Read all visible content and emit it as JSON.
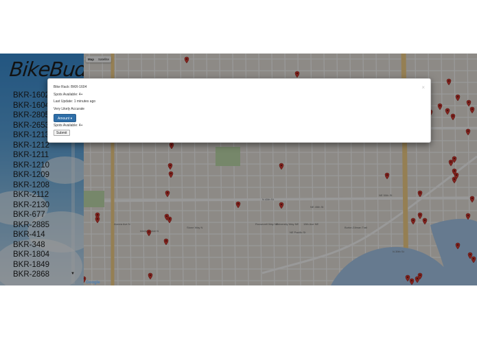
{
  "app": {
    "logo": "BikeBud"
  },
  "sidebar": {
    "racks": [
      "BKR-1602",
      "BKR-1604",
      "BKR-2805",
      "BKR-2653",
      "BKR-1213",
      "BKR-1212",
      "BKR-1211",
      "BKR-1210",
      "BKR-1209",
      "BKR-1208",
      "BKR-2112",
      "BKR-2130",
      "BKR-677",
      "BKR-2885",
      "BKR-414",
      "BKR-348",
      "BKR-1804",
      "BKR-1849",
      "BKR-2868"
    ]
  },
  "map": {
    "type_map": "Map",
    "type_satellite": "Satellite",
    "google": "Google",
    "water_color": "#aacbee",
    "road_color": "#ffffff",
    "highway_color": "#f9d48b",
    "pin_color": "#d63b32",
    "labels": [
      "N 45th St",
      "NE 45th St",
      "NE 50th St",
      "NE Pacific St",
      "N 39th St",
      "Burke-Gilman Trail",
      "Woodland Park",
      "Aurora Ave N",
      "Interlake Ave N",
      "Stone Way N",
      "Roosevelt Way NE",
      "University Way NE",
      "15th Ave NE"
    ]
  },
  "modal": {
    "bike_rack": "Bike Rack: BKR-1604",
    "spots_available": "Spots Available: 4+",
    "last_update": "Last Update: 1 minutes ago",
    "accuracy": "Very Likely Accurate",
    "amount_label": "Amount",
    "spots_available_2": "Spots Available: 4+",
    "submit_label": "Submit",
    "close": "×"
  }
}
